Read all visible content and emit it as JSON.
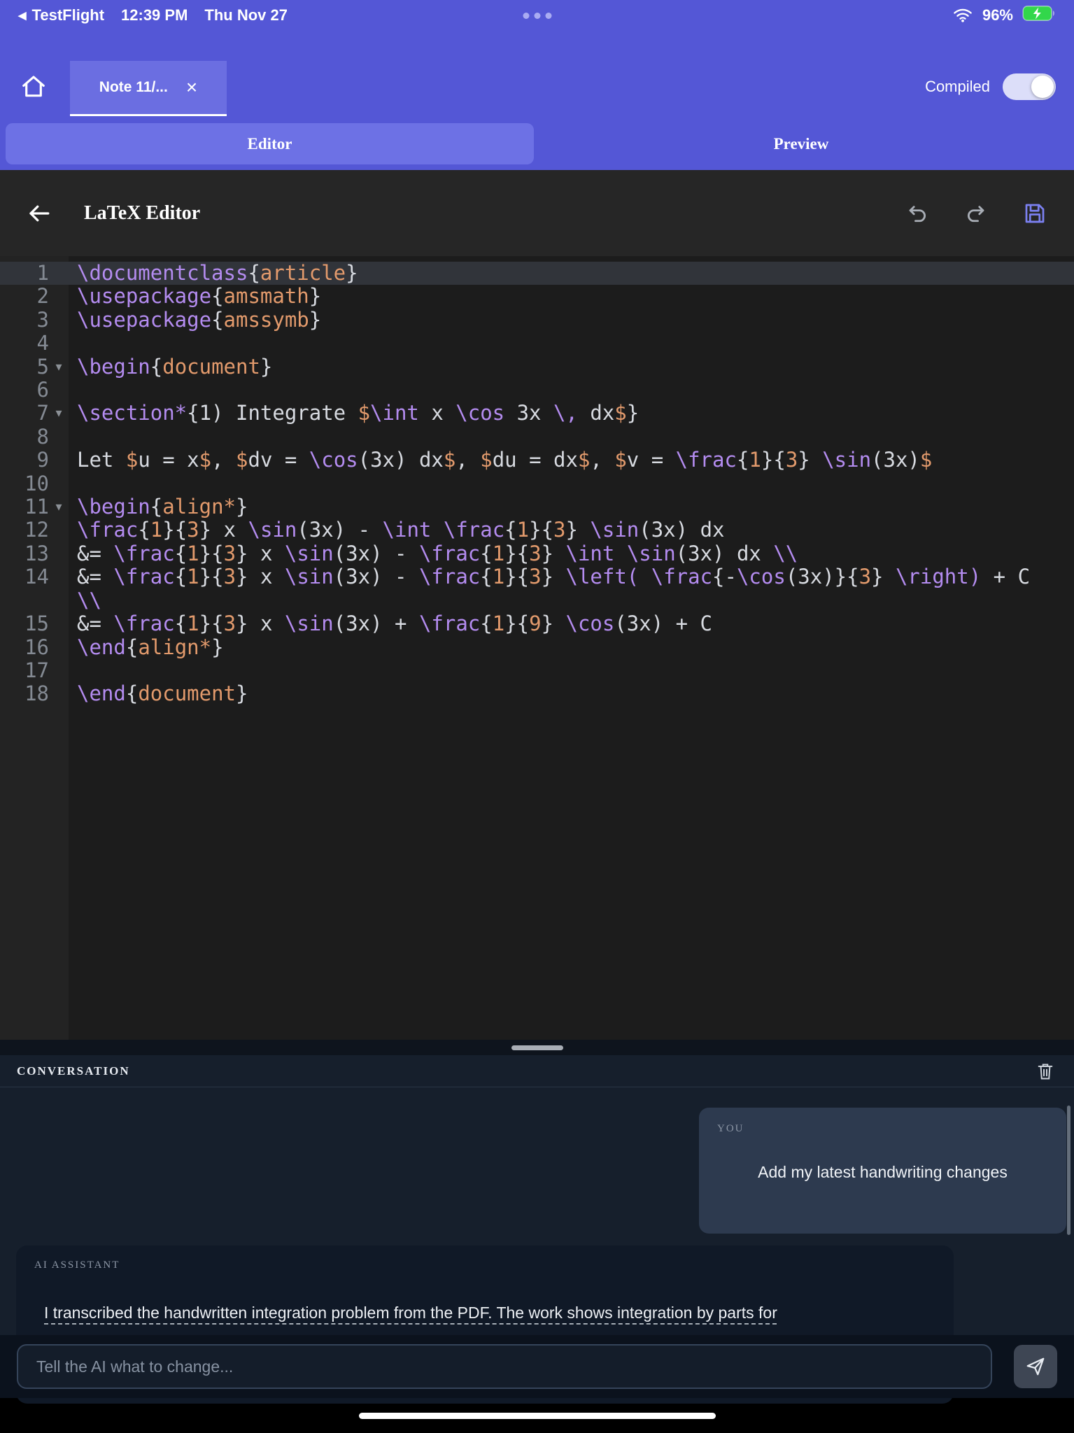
{
  "theme": {
    "accent": "#5457d6",
    "accent_light": "#6d71e5",
    "code_command": "#b48cf0",
    "code_argument": "#e29a6c",
    "code_plain": "#d7dae0",
    "battery_green": "#32d74b"
  },
  "status_bar": {
    "back_app": "TestFlight",
    "time": "12:39 PM",
    "date": "Thu Nov 27",
    "battery_percent": "96%"
  },
  "header": {
    "tab_label": "Note 11/...",
    "close_glyph": "×",
    "compiled_label": "Compiled",
    "compiled_on": true
  },
  "mode_tabs": [
    {
      "label": "Editor",
      "active": true
    },
    {
      "label": "Preview",
      "active": false
    }
  ],
  "editor": {
    "title": "LaTeX Editor",
    "lines": [
      {
        "n": 1,
        "active": true,
        "t": [
          [
            "c",
            "\\documentclass"
          ],
          [
            "p",
            "{"
          ],
          [
            "a",
            "article"
          ],
          [
            "p",
            "}"
          ]
        ]
      },
      {
        "n": 2,
        "t": [
          [
            "c",
            "\\usepackage"
          ],
          [
            "p",
            "{"
          ],
          [
            "a",
            "amsmath"
          ],
          [
            "p",
            "}"
          ]
        ]
      },
      {
        "n": 3,
        "t": [
          [
            "c",
            "\\usepackage"
          ],
          [
            "p",
            "{"
          ],
          [
            "a",
            "amssymb"
          ],
          [
            "p",
            "}"
          ]
        ]
      },
      {
        "n": 4,
        "t": []
      },
      {
        "n": 5,
        "f": true,
        "t": [
          [
            "c",
            "\\begin"
          ],
          [
            "p",
            "{"
          ],
          [
            "a",
            "document"
          ],
          [
            "p",
            "}"
          ]
        ]
      },
      {
        "n": 6,
        "t": []
      },
      {
        "n": 7,
        "f": true,
        "t": [
          [
            "c",
            "\\section*"
          ],
          [
            "p",
            "{1) Integrate "
          ],
          [
            "a",
            "$"
          ],
          [
            "c",
            "\\int"
          ],
          [
            "p",
            " x "
          ],
          [
            "c",
            "\\cos"
          ],
          [
            "p",
            " 3x "
          ],
          [
            "c",
            "\\,"
          ],
          [
            "p",
            " dx"
          ],
          [
            "a",
            "$"
          ],
          [
            "p",
            "}"
          ]
        ]
      },
      {
        "n": 8,
        "t": []
      },
      {
        "n": 9,
        "t": [
          [
            "p",
            "Let "
          ],
          [
            "a",
            "$"
          ],
          [
            "p",
            "u = x"
          ],
          [
            "a",
            "$"
          ],
          [
            "p",
            ", "
          ],
          [
            "a",
            "$"
          ],
          [
            "p",
            "dv = "
          ],
          [
            "c",
            "\\cos"
          ],
          [
            "p",
            "(3x) dx"
          ],
          [
            "a",
            "$"
          ],
          [
            "p",
            ", "
          ],
          [
            "a",
            "$"
          ],
          [
            "p",
            "du = dx"
          ],
          [
            "a",
            "$"
          ],
          [
            "p",
            ", "
          ],
          [
            "a",
            "$"
          ],
          [
            "p",
            "v = "
          ],
          [
            "c",
            "\\frac"
          ],
          [
            "p",
            "{"
          ],
          [
            "a",
            "1"
          ],
          [
            "p",
            "}{"
          ],
          [
            "a",
            "3"
          ],
          [
            "p",
            "} "
          ],
          [
            "c",
            "\\sin"
          ],
          [
            "p",
            "(3x)"
          ],
          [
            "a",
            "$"
          ]
        ]
      },
      {
        "n": 10,
        "t": []
      },
      {
        "n": 11,
        "f": true,
        "t": [
          [
            "c",
            "\\begin"
          ],
          [
            "p",
            "{"
          ],
          [
            "a",
            "align*"
          ],
          [
            "p",
            "}"
          ]
        ]
      },
      {
        "n": 12,
        "t": [
          [
            "c",
            "\\frac"
          ],
          [
            "p",
            "{"
          ],
          [
            "a",
            "1"
          ],
          [
            "p",
            "}{"
          ],
          [
            "a",
            "3"
          ],
          [
            "p",
            "} x "
          ],
          [
            "c",
            "\\sin"
          ],
          [
            "p",
            "(3x) - "
          ],
          [
            "c",
            "\\int"
          ],
          [
            "p",
            " "
          ],
          [
            "c",
            "\\frac"
          ],
          [
            "p",
            "{"
          ],
          [
            "a",
            "1"
          ],
          [
            "p",
            "}{"
          ],
          [
            "a",
            "3"
          ],
          [
            "p",
            "} "
          ],
          [
            "c",
            "\\sin"
          ],
          [
            "p",
            "(3x) dx"
          ]
        ]
      },
      {
        "n": 13,
        "t": [
          [
            "p",
            "&= "
          ],
          [
            "c",
            "\\frac"
          ],
          [
            "p",
            "{"
          ],
          [
            "a",
            "1"
          ],
          [
            "p",
            "}{"
          ],
          [
            "a",
            "3"
          ],
          [
            "p",
            "} x "
          ],
          [
            "c",
            "\\sin"
          ],
          [
            "p",
            "(3x) - "
          ],
          [
            "c",
            "\\frac"
          ],
          [
            "p",
            "{"
          ],
          [
            "a",
            "1"
          ],
          [
            "p",
            "}{"
          ],
          [
            "a",
            "3"
          ],
          [
            "p",
            "} "
          ],
          [
            "c",
            "\\int"
          ],
          [
            "p",
            " "
          ],
          [
            "c",
            "\\sin"
          ],
          [
            "p",
            "(3x) dx "
          ],
          [
            "c",
            "\\\\"
          ]
        ]
      },
      {
        "n": 14,
        "t": [
          [
            "p",
            "&= "
          ],
          [
            "c",
            "\\frac"
          ],
          [
            "p",
            "{"
          ],
          [
            "a",
            "1"
          ],
          [
            "p",
            "}{"
          ],
          [
            "a",
            "3"
          ],
          [
            "p",
            "} x "
          ],
          [
            "c",
            "\\sin"
          ],
          [
            "p",
            "(3x) - "
          ],
          [
            "c",
            "\\frac"
          ],
          [
            "p",
            "{"
          ],
          [
            "a",
            "1"
          ],
          [
            "p",
            "}{"
          ],
          [
            "a",
            "3"
          ],
          [
            "p",
            "} "
          ],
          [
            "c",
            "\\left("
          ],
          [
            "p",
            " "
          ],
          [
            "c",
            "\\frac"
          ],
          [
            "p",
            "{-"
          ],
          [
            "c",
            "\\cos"
          ],
          [
            "p",
            "(3x)}{"
          ],
          [
            "a",
            "3"
          ],
          [
            "p",
            "} "
          ],
          [
            "c",
            "\\right)"
          ],
          [
            "p",
            " + C "
          ],
          [
            "c",
            "\\\\"
          ]
        ]
      },
      {
        "n": 15,
        "t": [
          [
            "p",
            "&= "
          ],
          [
            "c",
            "\\frac"
          ],
          [
            "p",
            "{"
          ],
          [
            "a",
            "1"
          ],
          [
            "p",
            "}{"
          ],
          [
            "a",
            "3"
          ],
          [
            "p",
            "} x "
          ],
          [
            "c",
            "\\sin"
          ],
          [
            "p",
            "(3x) + "
          ],
          [
            "c",
            "\\frac"
          ],
          [
            "p",
            "{"
          ],
          [
            "a",
            "1"
          ],
          [
            "p",
            "}{"
          ],
          [
            "a",
            "9"
          ],
          [
            "p",
            "} "
          ],
          [
            "c",
            "\\cos"
          ],
          [
            "p",
            "(3x) + C"
          ]
        ]
      },
      {
        "n": 16,
        "t": [
          [
            "c",
            "\\end"
          ],
          [
            "p",
            "{"
          ],
          [
            "a",
            "align*"
          ],
          [
            "p",
            "}"
          ]
        ]
      },
      {
        "n": 17,
        "t": []
      },
      {
        "n": 18,
        "t": [
          [
            "c",
            "\\end"
          ],
          [
            "p",
            "{"
          ],
          [
            "a",
            "document"
          ],
          [
            "p",
            "}"
          ]
        ]
      }
    ]
  },
  "conversation": {
    "title": "CONVERSATION",
    "messages": [
      {
        "role": "YOU",
        "text": "Add my latest handwriting changes"
      },
      {
        "role": "AI ASSISTANT",
        "text": "I transcribed the handwritten integration problem from the PDF. The work shows integration by parts for"
      }
    ],
    "input_placeholder": "Tell the AI what to change..."
  }
}
